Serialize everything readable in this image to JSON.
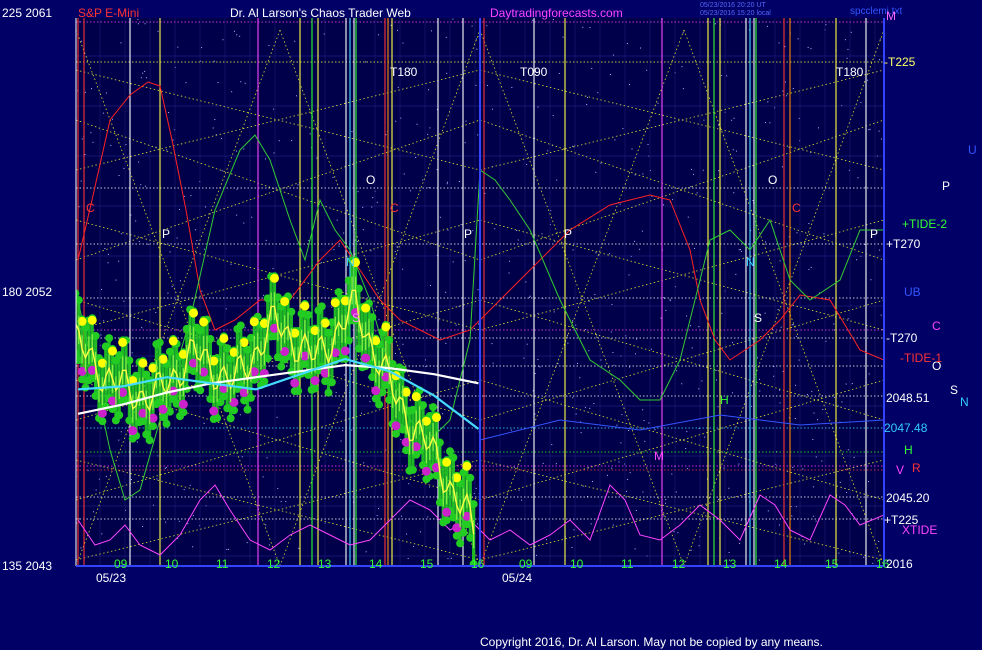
{
  "header": {
    "left_price_top": "225  2061",
    "instrument": "S&P E-Mini",
    "title": "Dr. Al Larson's Chaos Trader Web",
    "site": "Daytradingforecasts.com",
    "stamp_line1": "05/23/2016 20:20 UT",
    "stamp_line2": "05/23/2016 15:20 local",
    "chart_code": "spcclemi.txt"
  },
  "left_axis": {
    "mid": "180  2052",
    "bottom": "135  2043"
  },
  "right_labels": [
    {
      "text": "M",
      "color": "#ff66ff"
    },
    {
      "text": "-T225",
      "color": "#ffff66"
    },
    {
      "text": "U",
      "color": "#3355ff"
    },
    {
      "text": "P",
      "color": "#ffffff"
    },
    {
      "text": "+TIDE-2",
      "color": "#33ff33"
    },
    {
      "text": "+T270",
      "color": "#ffffff"
    },
    {
      "text": "UB",
      "color": "#3355ff"
    },
    {
      "text": "C",
      "color": "#ff44ff"
    },
    {
      "text": "-T270",
      "color": "#ffffff"
    },
    {
      "text": "O",
      "color": "#ffffff"
    },
    {
      "text": "-TIDE-1",
      "color": "#ff3333"
    },
    {
      "text": "S",
      "color": "#ffffff"
    },
    {
      "text": "N",
      "color": "#33ccff"
    },
    {
      "text": "2048.51",
      "color": "#ffffff"
    },
    {
      "text": "2047.48",
      "color": "#33ccff"
    },
    {
      "text": "H",
      "color": "#33ff33"
    },
    {
      "text": "V",
      "color": "#ff44ff"
    },
    {
      "text": "R",
      "color": "#ff3333"
    },
    {
      "text": "2045.20",
      "color": "#ffffff"
    },
    {
      "text": "+T225",
      "color": "#ffffff"
    },
    {
      "text": "XTIDE",
      "color": "#ff44ff"
    },
    {
      "text": "2016",
      "color": "#ffffff"
    }
  ],
  "markers": [
    {
      "text": "T180",
      "color": "#ffffff"
    },
    {
      "text": "T090",
      "color": "#ffffff"
    },
    {
      "text": "T180",
      "color": "#ffffff"
    },
    {
      "text": "C",
      "color": "#ff3333"
    },
    {
      "text": "P",
      "color": "#ffffff"
    },
    {
      "text": "O",
      "color": "#ffffff"
    },
    {
      "text": "C",
      "color": "#ff3333"
    },
    {
      "text": "N",
      "color": "#33ccff"
    },
    {
      "text": "S",
      "color": "#ff88ff"
    },
    {
      "text": "P",
      "color": "#ffffff"
    },
    {
      "text": "P",
      "color": "#ffffff"
    },
    {
      "text": "O",
      "color": "#ffffff"
    },
    {
      "text": "C",
      "color": "#ff3333"
    },
    {
      "text": "N",
      "color": "#33ccff"
    },
    {
      "text": "S",
      "color": "#ffffff"
    },
    {
      "text": "H",
      "color": "#33ff33"
    },
    {
      "text": "M",
      "color": "#ff44ff"
    },
    {
      "text": "P",
      "color": "#ffffff"
    }
  ],
  "footer": {
    "copyright": "Copyright 2016, Dr. Al Larson. May not be copied by any means."
  },
  "chart_data": {
    "type": "line",
    "x_axis": {
      "day1_label": "05/23",
      "day2_label": "05/24",
      "day1_hours": [
        "09",
        "10",
        "11",
        "12",
        "13",
        "14",
        "15",
        "16"
      ],
      "day2_hours": [
        "09",
        "10",
        "11",
        "12",
        "13",
        "14",
        "15",
        "16"
      ]
    },
    "price_range": [
      2043,
      2061
    ],
    "price_series_hourly": [
      2050.5,
      2049.0,
      2048.5,
      2050.0,
      2049.0,
      2051.0,
      2049.8,
      2051.5,
      2048.5,
      2046.5,
      2044.0
    ],
    "white_ma_hourly": [
      2048.0,
      2048.3,
      2048.7,
      2049.0,
      2049.2,
      2049.4,
      2049.6,
      2049.5,
      2049.3,
      2049.0
    ],
    "cyan_ma_hourly": [
      2048.8,
      2048.9,
      2049.2,
      2049.0,
      2048.8,
      2049.3,
      2049.8,
      2049.4,
      2048.6,
      2047.5
    ],
    "colors": {
      "background": "#000066",
      "price": "#ffff44",
      "band": "#22cc22",
      "highs": "#ffff00",
      "lows": "#cc22cc",
      "ma_white": "#ffffff",
      "ma_cyan": "#44ddff",
      "tide1": "#ff2222",
      "tide2": "#33cc33",
      "xtide": "#ff44ff"
    }
  }
}
